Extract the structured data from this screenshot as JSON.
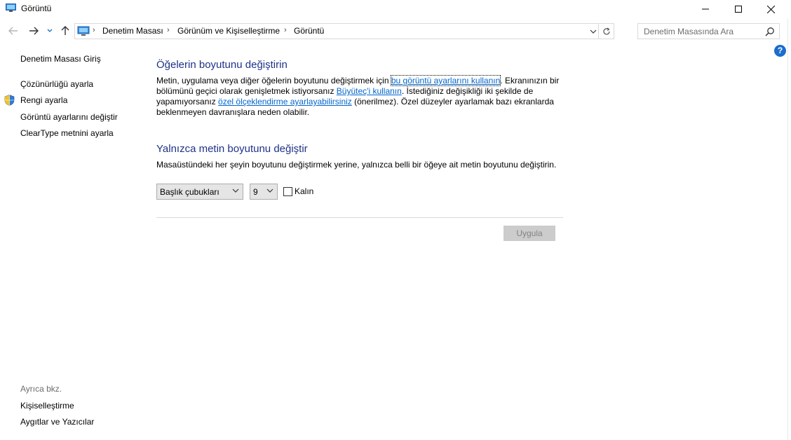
{
  "window": {
    "title": "Görüntü",
    "icons": [
      "monitor-icon",
      "minimize-icon",
      "maximize-icon",
      "close-icon"
    ]
  },
  "navigation": {
    "icons": [
      "back-arrow-icon",
      "forward-arrow-icon",
      "recent-dropdown-icon",
      "up-arrow-icon"
    ]
  },
  "address": {
    "breadcrumbs": [
      "Denetim Masası",
      "Görünüm ve Kişiselleştirme",
      "Görüntü"
    ],
    "separator": "›"
  },
  "search": {
    "placeholder": "Denetim Masasında Ara"
  },
  "help": {
    "label": "?"
  },
  "sidebar": {
    "home": "Denetim Masası Giriş",
    "items": [
      "Çözünürlüğü ayarla",
      "Rengi ayarla",
      "Görüntü ayarlarını değiştir",
      "ClearType metnini ayarla"
    ],
    "see_also_label": "Ayrıca bkz.",
    "see_also": [
      "Kişiselleştirme",
      "Aygıtlar ve Yazıcılar"
    ]
  },
  "main": {
    "section1": {
      "title": "Öğelerin boyutunu değiştirin",
      "text_1": "Metin, uygulama veya diğer öğelerin boyutunu değiştirmek için ",
      "link_1": "bu görüntü ayarlarını kullanın",
      "text_2": ". Ekranınızın bir bölümünü geçici olarak genişletmek istiyorsanız ",
      "link_2": "Büyüteç'i kullanın",
      "text_3": ". İstediğiniz değişikliği iki şekilde de yapamıyorsanız ",
      "link_3": "özel ölçeklendirme ayarlayabilirsiniz",
      "text_4": " (önerilmez). Özel düzeyler ayarlamak bazı ekranlarda beklenmeyen davranışlara neden olabilir."
    },
    "section2": {
      "title": "Yalnızca metin boyutunu değiştir",
      "description": "Masaüstündeki her şeyin boyutunu değiştirmek yerine, yalnızca belli bir öğeye ait metin boyutunu değiştirin.",
      "item_select_value": "Başlık çubukları",
      "size_select_value": "9",
      "bold_label": "Kalın",
      "bold_checked": false
    },
    "apply_button": "Uygula"
  }
}
